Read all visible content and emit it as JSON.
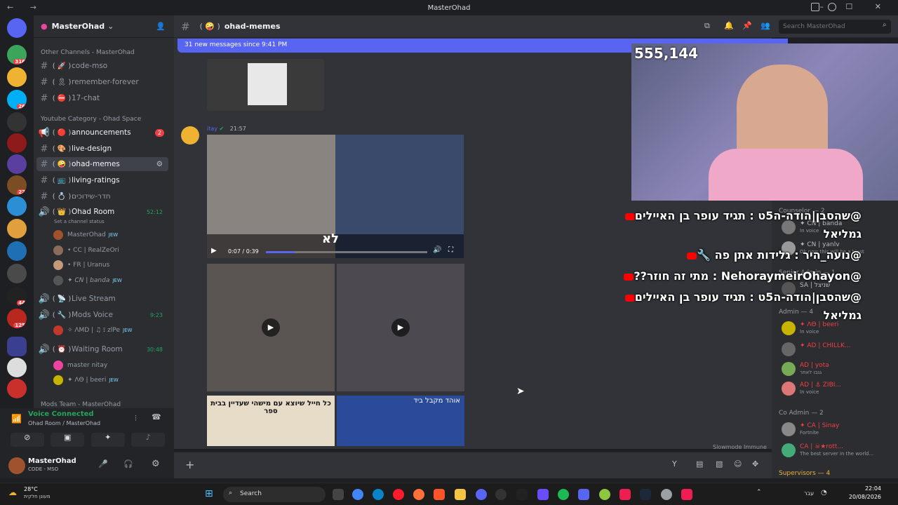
{
  "window": {
    "title": "MasterOhad"
  },
  "server": {
    "name": "MasterOhad"
  },
  "channel_list": {
    "cat_other": "Other Channels - MasterOhad",
    "cat_youtube": "Youtube Category - Ohad Space",
    "cat_mods": "Mods Team - MasterOhad",
    "channels": [
      {
        "emoji": "( 🚀 )",
        "label": "code-mso"
      },
      {
        "emoji": "( 🎗 )",
        "label": "remember-forever"
      },
      {
        "emoji": "( ⛔ )",
        "label": "17-chat"
      },
      {
        "emoji": "( 🔴 )",
        "label": "announcements",
        "badge": "2"
      },
      {
        "emoji": "( 🎨 )",
        "label": "live-design"
      },
      {
        "emoji": "( 🤪 )",
        "label": "ohad-memes"
      },
      {
        "emoji": "( 📺 )",
        "label": "living-ratings"
      },
      {
        "emoji": "( 💍 )",
        "label": "חדר-שידוכים"
      }
    ],
    "voice": [
      {
        "emoji": "( 👑 )",
        "label": "Ohad Room",
        "time": "52:12",
        "status": "Set a channel status"
      },
      {
        "emoji": "( 📡 )",
        "label": "Live Stream"
      },
      {
        "emoji": "( 🔧 )",
        "label": "Mods Voice",
        "time": "9:23"
      },
      {
        "emoji": "( ⏰ )",
        "label": "Waiting Room",
        "time": "30:48"
      }
    ],
    "voice_users": [
      {
        "name": "MasterOhad",
        "tag": "JEW"
      },
      {
        "name": "• CC | RealZeOri",
        "tag": ""
      },
      {
        "name": "• FR | Uranus",
        "tag": ""
      },
      {
        "name": "✦ CN | banda",
        "tag": "JEW"
      },
      {
        "name": "✧ ΛΜD | ♫ ⟟ zlPe",
        "tag": "JEW"
      },
      {
        "name": "master nitay",
        "tag": ""
      },
      {
        "name": "✦ ΛΘ | beeri",
        "tag": "JEW"
      }
    ]
  },
  "voice_panel": {
    "status": "Voice Connected",
    "location": "Ohad Room / MasterOhad"
  },
  "user_panel": {
    "name": "MasterOhad",
    "status": "CODE - MSO"
  },
  "chat_header": {
    "channel": "ohad-memes",
    "emoji": "( 🤪 )",
    "search_placeholder": "Search MasterOhad"
  },
  "banner": {
    "text": "31 new messages since 9:41 PM"
  },
  "message": {
    "author": "itay",
    "time": "21:57",
    "video_time": "0:07 / 0:39",
    "caption1": "לא",
    "tile3_text": "כל חייל שיוצא עם מישהי שעדיין בבית ספר",
    "tile4_text": "אוהד מקבל ביד"
  },
  "webcam": {
    "counter": "555,144"
  },
  "overlay": [
    {
      "text": "@שהסבן|הודה-ה5ט : תגיד עופר בן האיילים"
    },
    {
      "text": "גמליאל"
    },
    {
      "text": "@נועה_היר : גלידות אתן פה 🔧"
    },
    {
      "text": "@NehoraymeirOhayon : מתי זה חוזר??"
    },
    {
      "text": "@שהסבן|הודה-ה5ט : תגיד עופר בן האיילים"
    },
    {
      "text": "גמליאל"
    }
  ],
  "members": {
    "counselor": "Counselor — 2",
    "senior_admin": "Senior Admin — 1",
    "admin": "Admin — 4",
    "co_admin": "Co Admin — 2",
    "supervisors": "Supervisors — 4",
    "list": [
      {
        "name": "✦ CN | banda",
        "status": "In voice"
      },
      {
        "name": "✦ CN | yanlv",
        "status": "Ok now this will be a blast"
      },
      {
        "name": "SA | שניצל",
        "status": ""
      },
      {
        "name": "✦ ΛΘ | beeri",
        "status": "In voice"
      },
      {
        "name": "✦ AD | CHILLK...",
        "status": ""
      },
      {
        "name": "AD | yota",
        "status": "גנבו לאתר"
      },
      {
        "name": "AD | ⚓ ZIBI...",
        "status": "In voice"
      },
      {
        "name": "✦ CA | Sinay",
        "status": "Fortnite"
      },
      {
        "name": "CA | ☠★rott...",
        "status": "The best server in the world..."
      }
    ],
    "slowmode": "Slowmode Immune"
  },
  "taskbar": {
    "weather": "28°C",
    "weather_sub": "מעונן חלקית",
    "search": "Search",
    "lang": "עבר",
    "time": "22:04",
    "date": "20/08/2026"
  }
}
